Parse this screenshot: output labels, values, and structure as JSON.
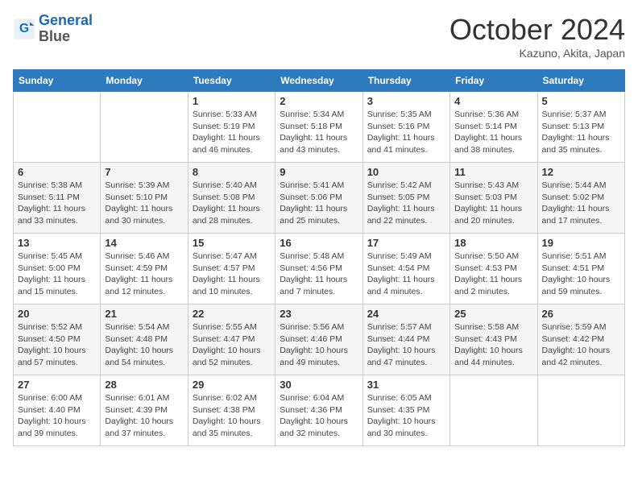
{
  "header": {
    "logo_line1": "General",
    "logo_line2": "Blue",
    "month_title": "October 2024",
    "subtitle": "Kazuno, Akita, Japan"
  },
  "days_of_week": [
    "Sunday",
    "Monday",
    "Tuesday",
    "Wednesday",
    "Thursday",
    "Friday",
    "Saturday"
  ],
  "weeks": [
    [
      {
        "day": "",
        "info": ""
      },
      {
        "day": "",
        "info": ""
      },
      {
        "day": "1",
        "info": "Sunrise: 5:33 AM\nSunset: 5:19 PM\nDaylight: 11 hours and 46 minutes."
      },
      {
        "day": "2",
        "info": "Sunrise: 5:34 AM\nSunset: 5:18 PM\nDaylight: 11 hours and 43 minutes."
      },
      {
        "day": "3",
        "info": "Sunrise: 5:35 AM\nSunset: 5:16 PM\nDaylight: 11 hours and 41 minutes."
      },
      {
        "day": "4",
        "info": "Sunrise: 5:36 AM\nSunset: 5:14 PM\nDaylight: 11 hours and 38 minutes."
      },
      {
        "day": "5",
        "info": "Sunrise: 5:37 AM\nSunset: 5:13 PM\nDaylight: 11 hours and 35 minutes."
      }
    ],
    [
      {
        "day": "6",
        "info": "Sunrise: 5:38 AM\nSunset: 5:11 PM\nDaylight: 11 hours and 33 minutes."
      },
      {
        "day": "7",
        "info": "Sunrise: 5:39 AM\nSunset: 5:10 PM\nDaylight: 11 hours and 30 minutes."
      },
      {
        "day": "8",
        "info": "Sunrise: 5:40 AM\nSunset: 5:08 PM\nDaylight: 11 hours and 28 minutes."
      },
      {
        "day": "9",
        "info": "Sunrise: 5:41 AM\nSunset: 5:06 PM\nDaylight: 11 hours and 25 minutes."
      },
      {
        "day": "10",
        "info": "Sunrise: 5:42 AM\nSunset: 5:05 PM\nDaylight: 11 hours and 22 minutes."
      },
      {
        "day": "11",
        "info": "Sunrise: 5:43 AM\nSunset: 5:03 PM\nDaylight: 11 hours and 20 minutes."
      },
      {
        "day": "12",
        "info": "Sunrise: 5:44 AM\nSunset: 5:02 PM\nDaylight: 11 hours and 17 minutes."
      }
    ],
    [
      {
        "day": "13",
        "info": "Sunrise: 5:45 AM\nSunset: 5:00 PM\nDaylight: 11 hours and 15 minutes."
      },
      {
        "day": "14",
        "info": "Sunrise: 5:46 AM\nSunset: 4:59 PM\nDaylight: 11 hours and 12 minutes."
      },
      {
        "day": "15",
        "info": "Sunrise: 5:47 AM\nSunset: 4:57 PM\nDaylight: 11 hours and 10 minutes."
      },
      {
        "day": "16",
        "info": "Sunrise: 5:48 AM\nSunset: 4:56 PM\nDaylight: 11 hours and 7 minutes."
      },
      {
        "day": "17",
        "info": "Sunrise: 5:49 AM\nSunset: 4:54 PM\nDaylight: 11 hours and 4 minutes."
      },
      {
        "day": "18",
        "info": "Sunrise: 5:50 AM\nSunset: 4:53 PM\nDaylight: 11 hours and 2 minutes."
      },
      {
        "day": "19",
        "info": "Sunrise: 5:51 AM\nSunset: 4:51 PM\nDaylight: 10 hours and 59 minutes."
      }
    ],
    [
      {
        "day": "20",
        "info": "Sunrise: 5:52 AM\nSunset: 4:50 PM\nDaylight: 10 hours and 57 minutes."
      },
      {
        "day": "21",
        "info": "Sunrise: 5:54 AM\nSunset: 4:48 PM\nDaylight: 10 hours and 54 minutes."
      },
      {
        "day": "22",
        "info": "Sunrise: 5:55 AM\nSunset: 4:47 PM\nDaylight: 10 hours and 52 minutes."
      },
      {
        "day": "23",
        "info": "Sunrise: 5:56 AM\nSunset: 4:46 PM\nDaylight: 10 hours and 49 minutes."
      },
      {
        "day": "24",
        "info": "Sunrise: 5:57 AM\nSunset: 4:44 PM\nDaylight: 10 hours and 47 minutes."
      },
      {
        "day": "25",
        "info": "Sunrise: 5:58 AM\nSunset: 4:43 PM\nDaylight: 10 hours and 44 minutes."
      },
      {
        "day": "26",
        "info": "Sunrise: 5:59 AM\nSunset: 4:42 PM\nDaylight: 10 hours and 42 minutes."
      }
    ],
    [
      {
        "day": "27",
        "info": "Sunrise: 6:00 AM\nSunset: 4:40 PM\nDaylight: 10 hours and 39 minutes."
      },
      {
        "day": "28",
        "info": "Sunrise: 6:01 AM\nSunset: 4:39 PM\nDaylight: 10 hours and 37 minutes."
      },
      {
        "day": "29",
        "info": "Sunrise: 6:02 AM\nSunset: 4:38 PM\nDaylight: 10 hours and 35 minutes."
      },
      {
        "day": "30",
        "info": "Sunrise: 6:04 AM\nSunset: 4:36 PM\nDaylight: 10 hours and 32 minutes."
      },
      {
        "day": "31",
        "info": "Sunrise: 6:05 AM\nSunset: 4:35 PM\nDaylight: 10 hours and 30 minutes."
      },
      {
        "day": "",
        "info": ""
      },
      {
        "day": "",
        "info": ""
      }
    ]
  ]
}
